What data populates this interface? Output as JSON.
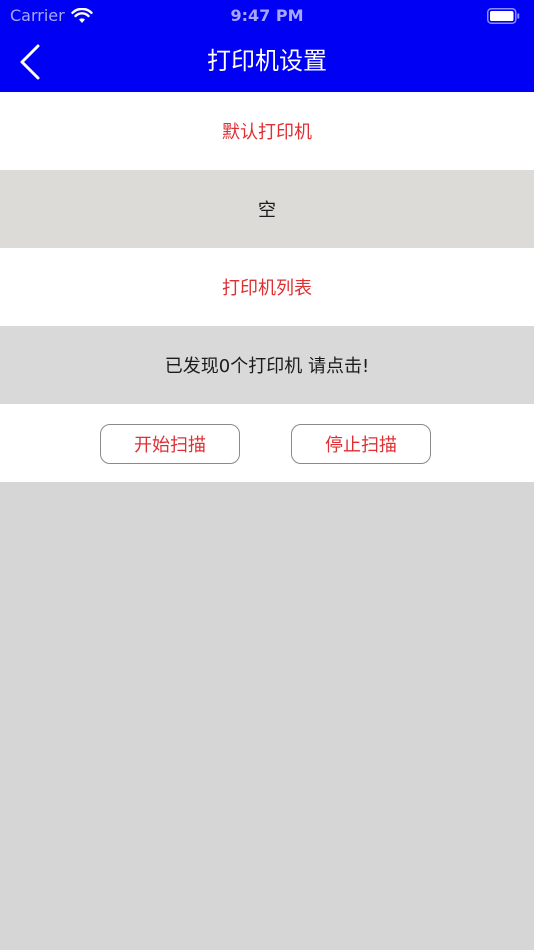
{
  "status_bar": {
    "carrier": "Carrier",
    "time": "9:47 PM",
    "wifi_icon": "wifi-icon",
    "battery_icon": "battery-icon"
  },
  "nav": {
    "title": "打印机设置",
    "back_icon": "chevron-left-icon",
    "background_color": "#0000f5"
  },
  "default_printer": {
    "header": "默认打印机",
    "value": "空"
  },
  "printer_list": {
    "header": "打印机列表",
    "status": "已发现0个打印机 请点击!"
  },
  "actions": {
    "start_scan": "开始扫描",
    "stop_scan": "停止扫描"
  },
  "colors": {
    "accent_red": "#e02f33",
    "row_grey": "#dcdbd7",
    "page_grey": "#d6d6d6"
  }
}
